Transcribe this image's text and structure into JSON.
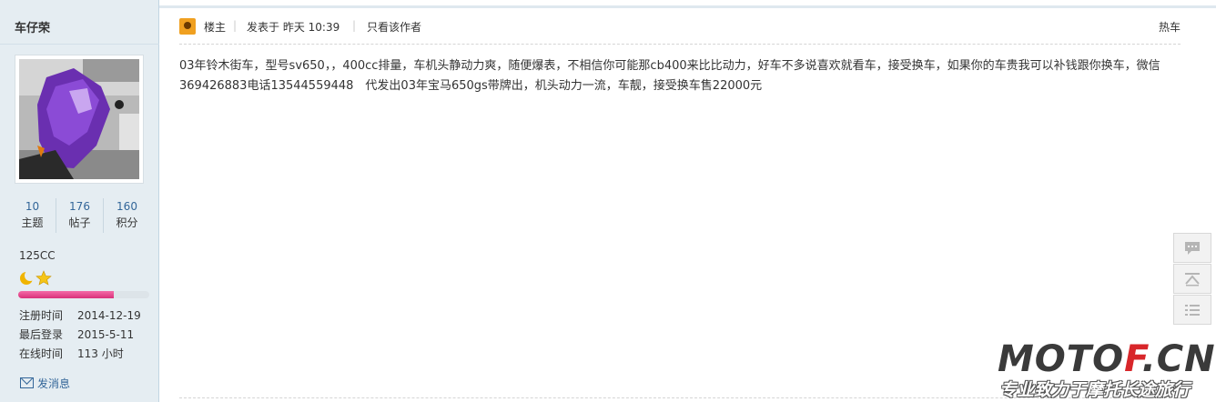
{
  "user": {
    "name": "车仔荣",
    "stats": [
      {
        "value": "10",
        "label": "主题"
      },
      {
        "value": "176",
        "label": "帖子"
      },
      {
        "value": "160",
        "label": "积分"
      }
    ],
    "rank": "125CC",
    "rank_icons": [
      "moon-icon",
      "star-icon"
    ],
    "progress_fraction": 0.73,
    "info": [
      {
        "key": "注册时间",
        "value": "2014-12-19"
      },
      {
        "key": "最后登录",
        "value": "2015-5-11"
      },
      {
        "key": "在线时间",
        "value": "113 小时"
      }
    ],
    "message_link": "发消息"
  },
  "post": {
    "owner_label": "楼主",
    "posted": "发表于 昨天 10:39",
    "author_only": "只看该作者",
    "tag": "热车",
    "body": "03年铃木街车，型号sv650，，400cc排量，车机头静动力爽，随便爆表，不相信你可能那cb400来比比动力，好车不多说喜欢就看车，接受换车，如果你的车贵我可以补钱跟你换车，微信369426883电话13544559448　代发出03年宝马650gs带牌出，机头动力一流，车靓，接受换车售22000元"
  },
  "float_buttons": [
    "comment-icon",
    "back-to-top-icon",
    "list-icon"
  ],
  "watermark": {
    "logo_dark": "MOTO",
    "logo_red": "F",
    "logo_end": ".CN",
    "slogan": "专业致力于摩托长途旅行"
  },
  "colors": {
    "sidebar_bg": "#e5edf2",
    "link": "#336699",
    "progress": "#e0408a",
    "logo_red": "#d8262a"
  }
}
